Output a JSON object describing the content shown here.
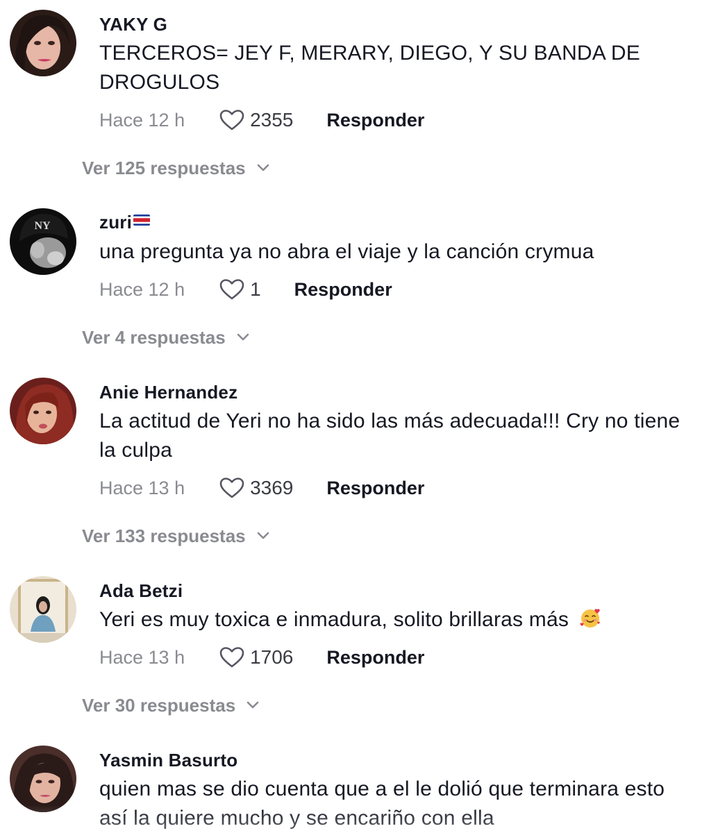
{
  "comments": [
    {
      "username": "YAKY G",
      "text": "TERCEROS= JEY F, MERARY, DIEGO, Y SU BANDA DE DROGULOS",
      "time": "Hace 12 h",
      "likes": "2355",
      "reply_label": "Responder",
      "replies_label": "Ver 125 respuestas"
    },
    {
      "username": "zuri",
      "username_flag": "costa-rica-flag",
      "text": "una pregunta ya no abra el viaje y la canción crymua",
      "time": "Hace 12 h",
      "likes": "1",
      "reply_label": "Responder",
      "replies_label": "Ver 4 respuestas"
    },
    {
      "username": "Anie Hernandez",
      "text": "La actitud de Yeri no ha sido las más adecuada!!! Cry no tiene la culpa",
      "time": "Hace 13 h",
      "likes": "3369",
      "reply_label": "Responder",
      "replies_label": "Ver 133 respuestas"
    },
    {
      "username": "Ada Betzi",
      "text": "Yeri es muy toxica e inmadura, solito brillaras más",
      "text_emoji": "smiling-face-with-hearts-emoji",
      "time": "Hace 13 h",
      "likes": "1706",
      "reply_label": "Responder",
      "replies_label": "Ver 30 respuestas"
    },
    {
      "username": "Yasmin Basurto",
      "text": "quien mas se dio cuenta que a el le dolió que terminara esto así la quiere mucho y se encariño con ella"
    }
  ],
  "icons": {
    "like": "heart-outline-icon",
    "expand": "chevron-down-icon"
  },
  "colors": {
    "text_primary": "#161823",
    "text_secondary": "#8a8b91"
  }
}
